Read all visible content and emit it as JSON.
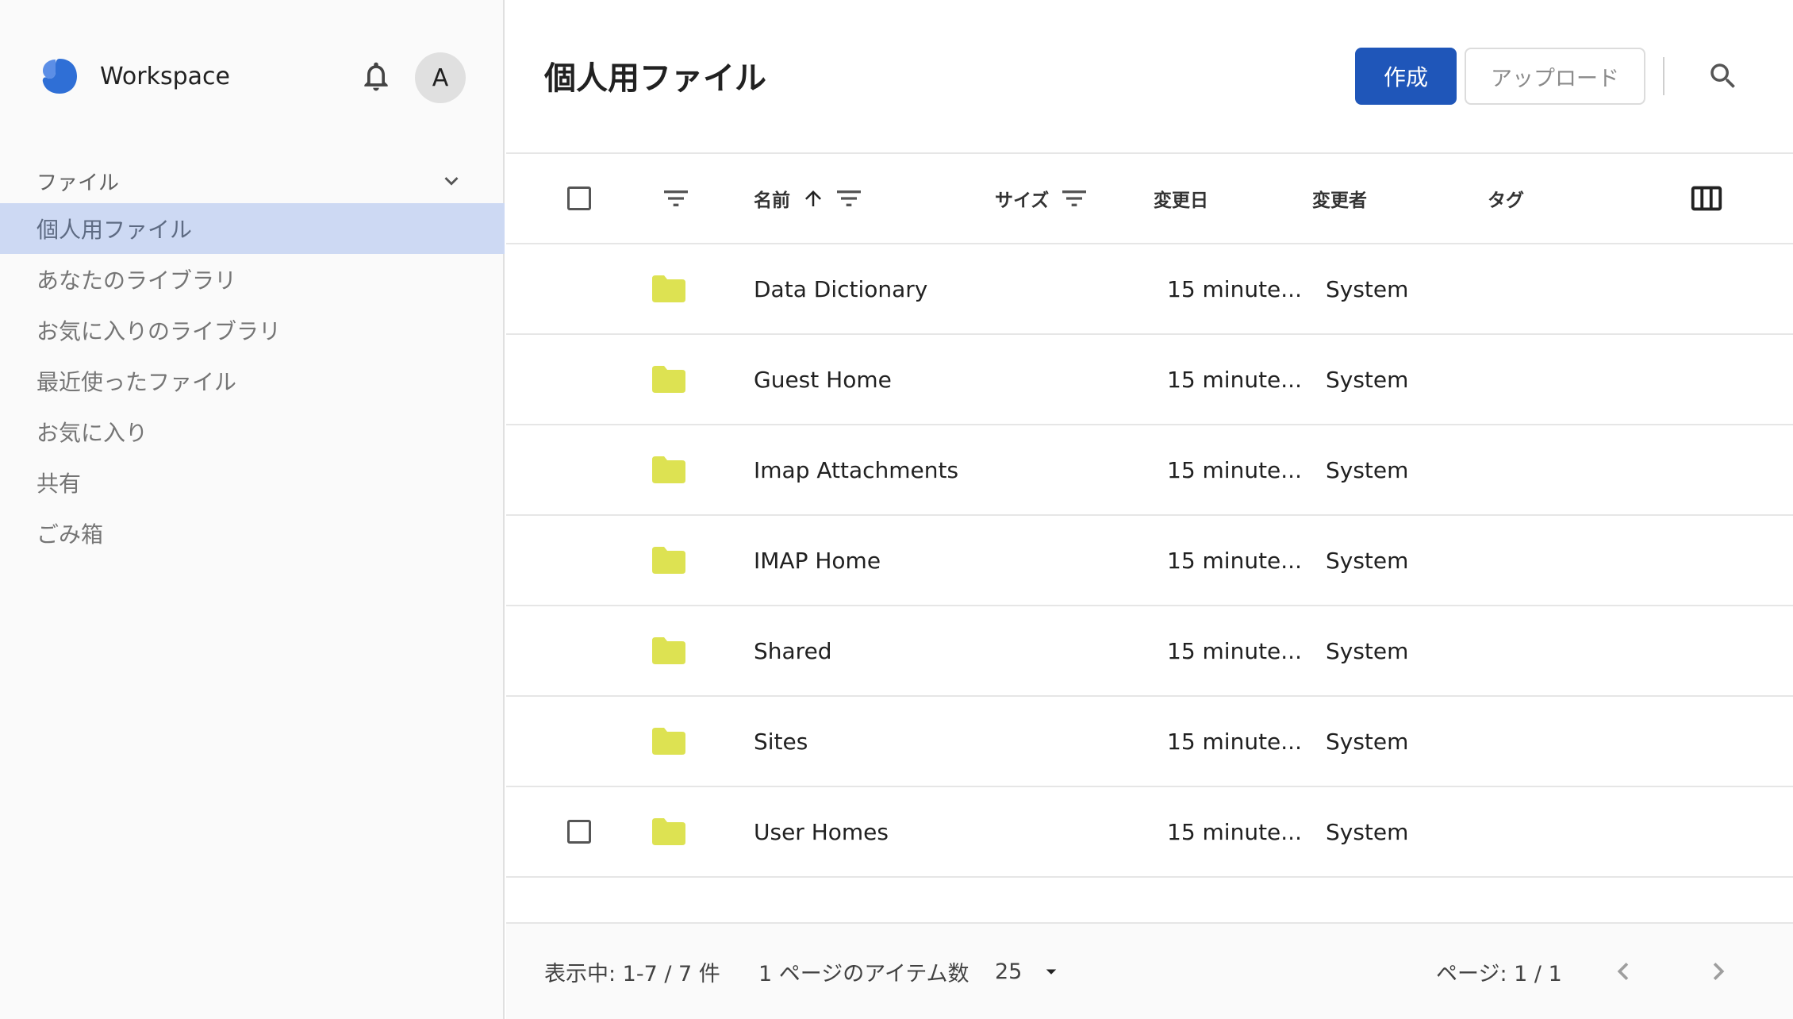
{
  "app": {
    "name": "Workspace",
    "avatar_initial": "A",
    "accent": "#1f56b9"
  },
  "sidebar": {
    "section_label": "ファイル",
    "items": [
      {
        "label": "個人用ファイル",
        "active": true
      },
      {
        "label": "あなたのライブラリ"
      },
      {
        "label": "お気に入りのライブラリ"
      },
      {
        "label": "最近使ったファイル"
      },
      {
        "label": "お気に入り"
      },
      {
        "label": "共有"
      },
      {
        "label": "ごみ箱"
      }
    ]
  },
  "header": {
    "title": "個人用ファイル",
    "create_label": "作成",
    "upload_label": "アップロード"
  },
  "table": {
    "columns": {
      "name": "名前",
      "size": "サイズ",
      "modified": "変更日",
      "modified_by": "変更者",
      "tags": "タグ"
    },
    "rows": [
      {
        "name": "Data Dictionary",
        "modified": "15 minute...",
        "modified_by": "System"
      },
      {
        "name": "Guest Home",
        "modified": "15 minute...",
        "modified_by": "System"
      },
      {
        "name": "Imap Attachments",
        "modified": "15 minute...",
        "modified_by": "System"
      },
      {
        "name": "IMAP Home",
        "modified": "15 minute...",
        "modified_by": "System"
      },
      {
        "name": "Shared",
        "modified": "15 minute...",
        "modified_by": "System"
      },
      {
        "name": "Sites",
        "modified": "15 minute...",
        "modified_by": "System"
      },
      {
        "name": "User Homes",
        "modified": "15 minute...",
        "modified_by": "System"
      }
    ],
    "folder_color": "#dde252"
  },
  "footer": {
    "range_text": "表示中: 1-7 / 7 件",
    "per_page_label": "1 ページのアイテム数",
    "per_page_value": "25",
    "page_text": "ページ: 1 / 1"
  }
}
